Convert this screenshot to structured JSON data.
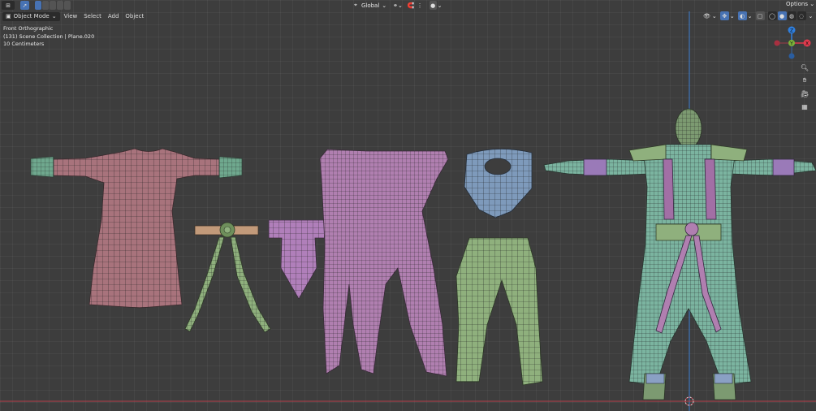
{
  "header": {
    "mode_label": "Object Mode",
    "menus": [
      "View",
      "Select",
      "Add",
      "Object"
    ],
    "transform_orientation": "Global",
    "options_label": "Options"
  },
  "overlay_info": {
    "view_name": "Front Orthographic",
    "collection_line": "(131) Scene Collection | Plane.020",
    "scale_line": "10 Centimeters"
  },
  "gizmo": {
    "axes": [
      {
        "name": "Z",
        "color": "#2f7fde"
      },
      {
        "name": "X",
        "color": "#e03a4d"
      },
      {
        "name": "Y",
        "color": "#7ab33a"
      }
    ]
  },
  "nav_icons": [
    "zoom-icon",
    "hand-pan-icon",
    "camera-icon",
    "grid-icon"
  ],
  "colors": {
    "background": "#3d3d3d",
    "pink_mesh": "#a8737c",
    "green_mesh": "#8fb07d",
    "purple_mesh": "#a26fa5",
    "blue_mesh": "#7e9abb",
    "teal_mesh": "#7bb4a0",
    "head_mesh": "#7c9a71"
  }
}
